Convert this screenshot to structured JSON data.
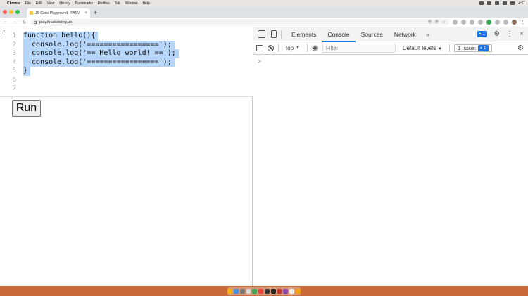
{
  "menubar": {
    "app": "Chrome",
    "items": [
      "File",
      "Edit",
      "View",
      "History",
      "Bookmarks",
      "Profiles",
      "Tab",
      "Window",
      "Help"
    ],
    "clock": "4:51"
  },
  "browser": {
    "tab_title": "JS Code Playground - PASV",
    "url": "play.localcoding.us"
  },
  "editor": {
    "lines": [
      {
        "num": "1",
        "code": "function hello(){"
      },
      {
        "num": "2",
        "code": "  console.log('=================');"
      },
      {
        "num": "3",
        "code": "  console.log('== Hello world! ==');"
      },
      {
        "num": "4",
        "code": "  console.log('=================');"
      },
      {
        "num": "5",
        "code": "}"
      },
      {
        "num": "6",
        "code": ""
      },
      {
        "num": "7",
        "code": ""
      }
    ],
    "run_label": "Run"
  },
  "devtools": {
    "tabs": [
      "Elements",
      "Console",
      "Sources",
      "Network"
    ],
    "active_tab": "Console",
    "more": "»",
    "message_count": "1",
    "context": "top",
    "filter_placeholder": "Filter",
    "levels": "Default levels",
    "issue_label": "1 Issue:",
    "issue_count": "1",
    "prompt": ">"
  },
  "colors": {
    "selection": "#b6d7fb",
    "accent": "#1a73e8"
  }
}
